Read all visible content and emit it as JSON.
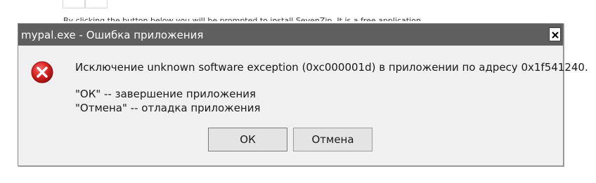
{
  "background": {
    "partial_text": "By clicking the button below you will be prompted to install SevenZip. It is a free application"
  },
  "dialog": {
    "title": "mypal.exe - Ошибка приложения",
    "close_icon": "close-icon",
    "error_icon": "error-icon",
    "message": "Исключение unknown software exception (0xc000001d) в приложении по адресу 0x1f541240.",
    "line_ok": "\"ОК\" -- завершение приложения",
    "line_cancel": "\"Отмена\" -- отладка приложения",
    "ok_label": "ОК",
    "cancel_label": "Отмена"
  },
  "colors": {
    "titlebar": "#5f5f5f",
    "dialog_bg": "#f0f0f0",
    "error_red": "#d42020"
  }
}
